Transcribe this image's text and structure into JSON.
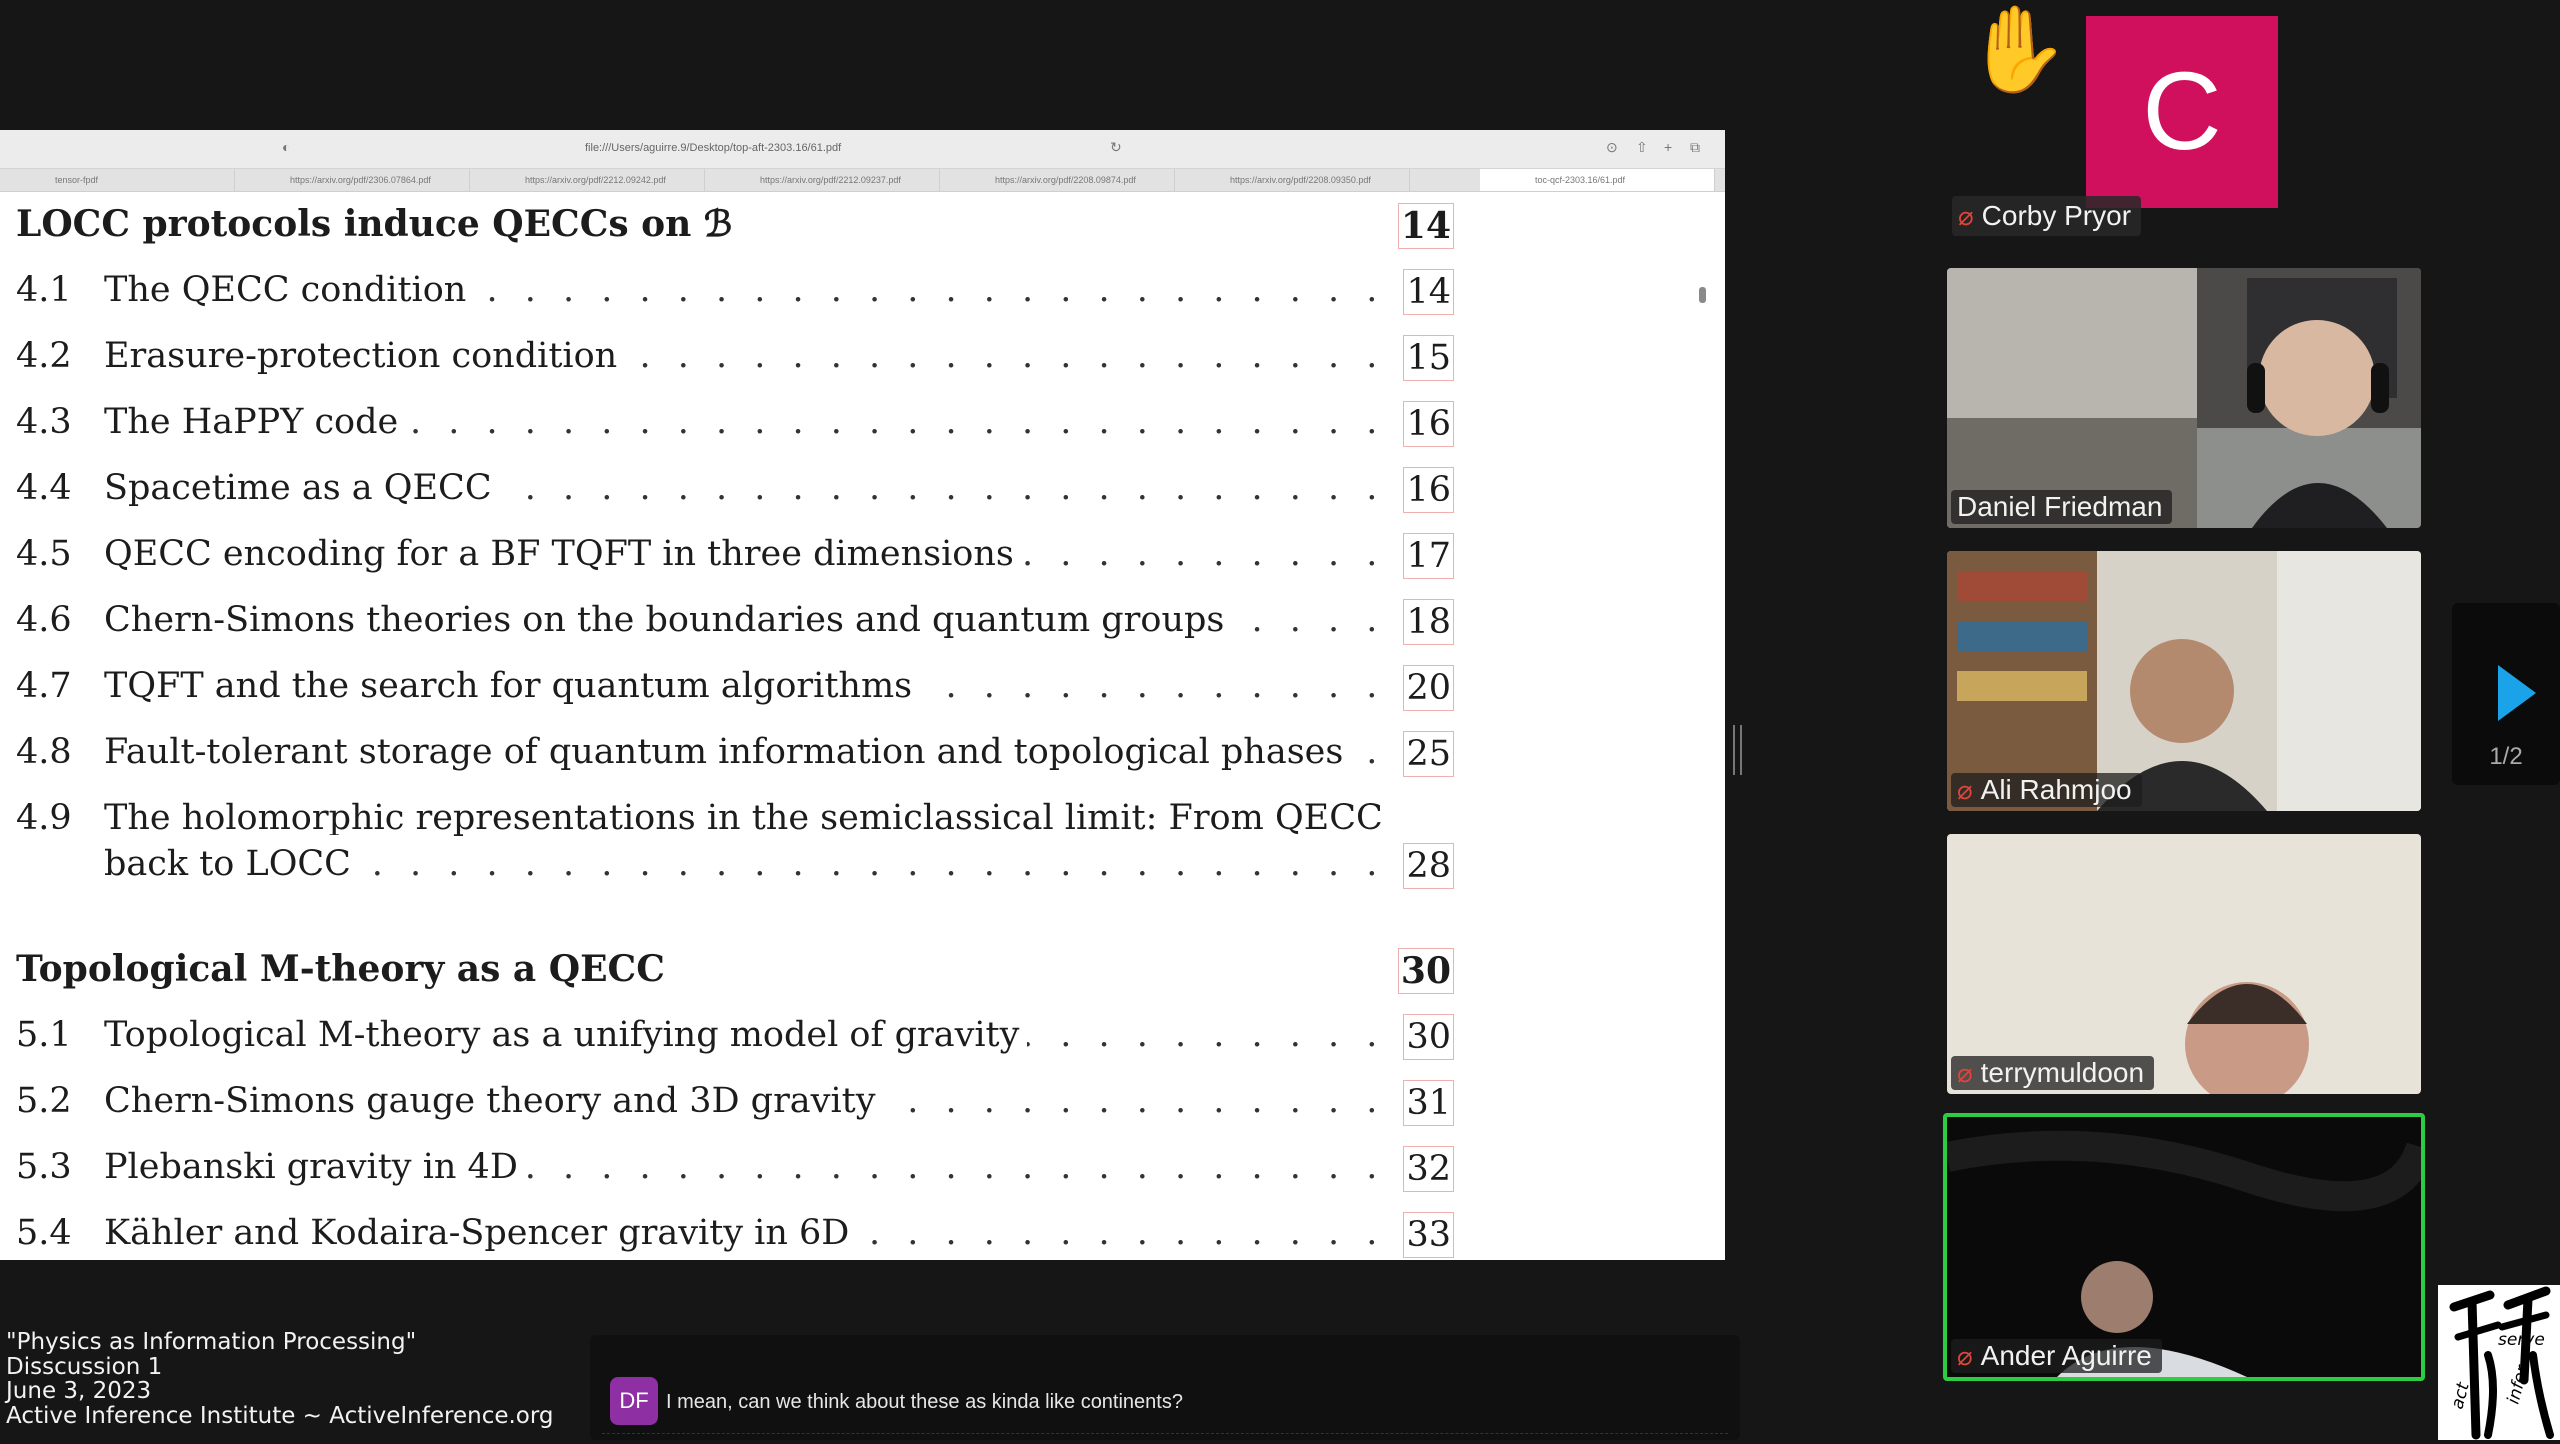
{
  "browser": {
    "url": "file:///Users/aguirre.9/Desktop/top-aft-2303.16/61.pdf",
    "tabs": [
      "tensor-fpdf",
      "https://arxiv.org/pdf/2306.07864.pdf",
      "https://arxiv.org/pdf/2212.09242.pdf",
      "https://arxiv.org/pdf/2212.09237.pdf",
      "https://arxiv.org/pdf/2208.09874.pdf",
      "https://arxiv.org/pdf/2208.09350.pdf",
      "toc-qcf-2303.16/61.pdf"
    ]
  },
  "toc": {
    "section4": {
      "title": "LOCC protocols induce QECCs on ℬ",
      "page": "14"
    },
    "section4_entries": [
      {
        "num": "4.1",
        "title": "The QECC condition",
        "page": "14"
      },
      {
        "num": "4.2",
        "title": "Erasure-protection condition",
        "page": "15"
      },
      {
        "num": "4.3",
        "title": "The HaPPY code",
        "page": "16"
      },
      {
        "num": "4.4",
        "title": "Spacetime as a QECC",
        "page": "16"
      },
      {
        "num": "4.5",
        "title": "QECC encoding for a BF TQFT in three dimensions",
        "page": "17"
      },
      {
        "num": "4.6",
        "title": "Chern-Simons theories on the boundaries and quantum groups",
        "page": "18"
      },
      {
        "num": "4.7",
        "title": "TQFT and the search for quantum algorithms",
        "page": "20"
      },
      {
        "num": "4.8",
        "title": "Fault-tolerant storage of quantum information and topological phases",
        "page": "25"
      },
      {
        "num": "4.9",
        "title": "The holomorphic representations in the semiclassical limit:  From QECC",
        "title2": "back to LOCC",
        "page": "28"
      }
    ],
    "section5": {
      "title": "Topological M-theory as a QECC",
      "page": "30"
    },
    "section5_entries": [
      {
        "num": "5.1",
        "title": "Topological M-theory as a unifying model of gravity",
        "page": "30"
      },
      {
        "num": "5.2",
        "title": "Chern-Simons gauge theory and 3D gravity",
        "page": "31"
      },
      {
        "num": "5.3",
        "title": "Plebanski gravity in 4D",
        "page": "32"
      },
      {
        "num": "5.4",
        "title": "Kähler and Kodaira-Spencer gravity in 6D",
        "page": "33"
      }
    ]
  },
  "participants": {
    "corby": {
      "initial": "C",
      "name": "Corby Pryor",
      "hand_icon": "✋"
    },
    "daniel": {
      "name": "Daniel Friedman"
    },
    "ali": {
      "name": "Ali Rahmjoo"
    },
    "terry": {
      "name": "terrymuldoon"
    },
    "ander": {
      "name": "Ander Aguirre"
    },
    "mic_icon": "🎤",
    "pager": "1/2"
  },
  "caption": {
    "line1": "\"Physics as Information Processing\"",
    "line2": "Disscussion 1",
    "line3": "June 3, 2023",
    "line4": "Active Inference Institute ~ ActiveInference.org"
  },
  "chat": {
    "initials": "DF",
    "message": "I mean, can we think about these as kinda like continents?"
  },
  "logo": {
    "text1": "serve",
    "text2": "act",
    "text3": "infer"
  },
  "colors": {
    "speaking_border": "#2ecc40",
    "avatar_bg": "#d0105c",
    "chat_avatar_bg": "#8e2fa3",
    "arrow": "#1aa3e8"
  }
}
